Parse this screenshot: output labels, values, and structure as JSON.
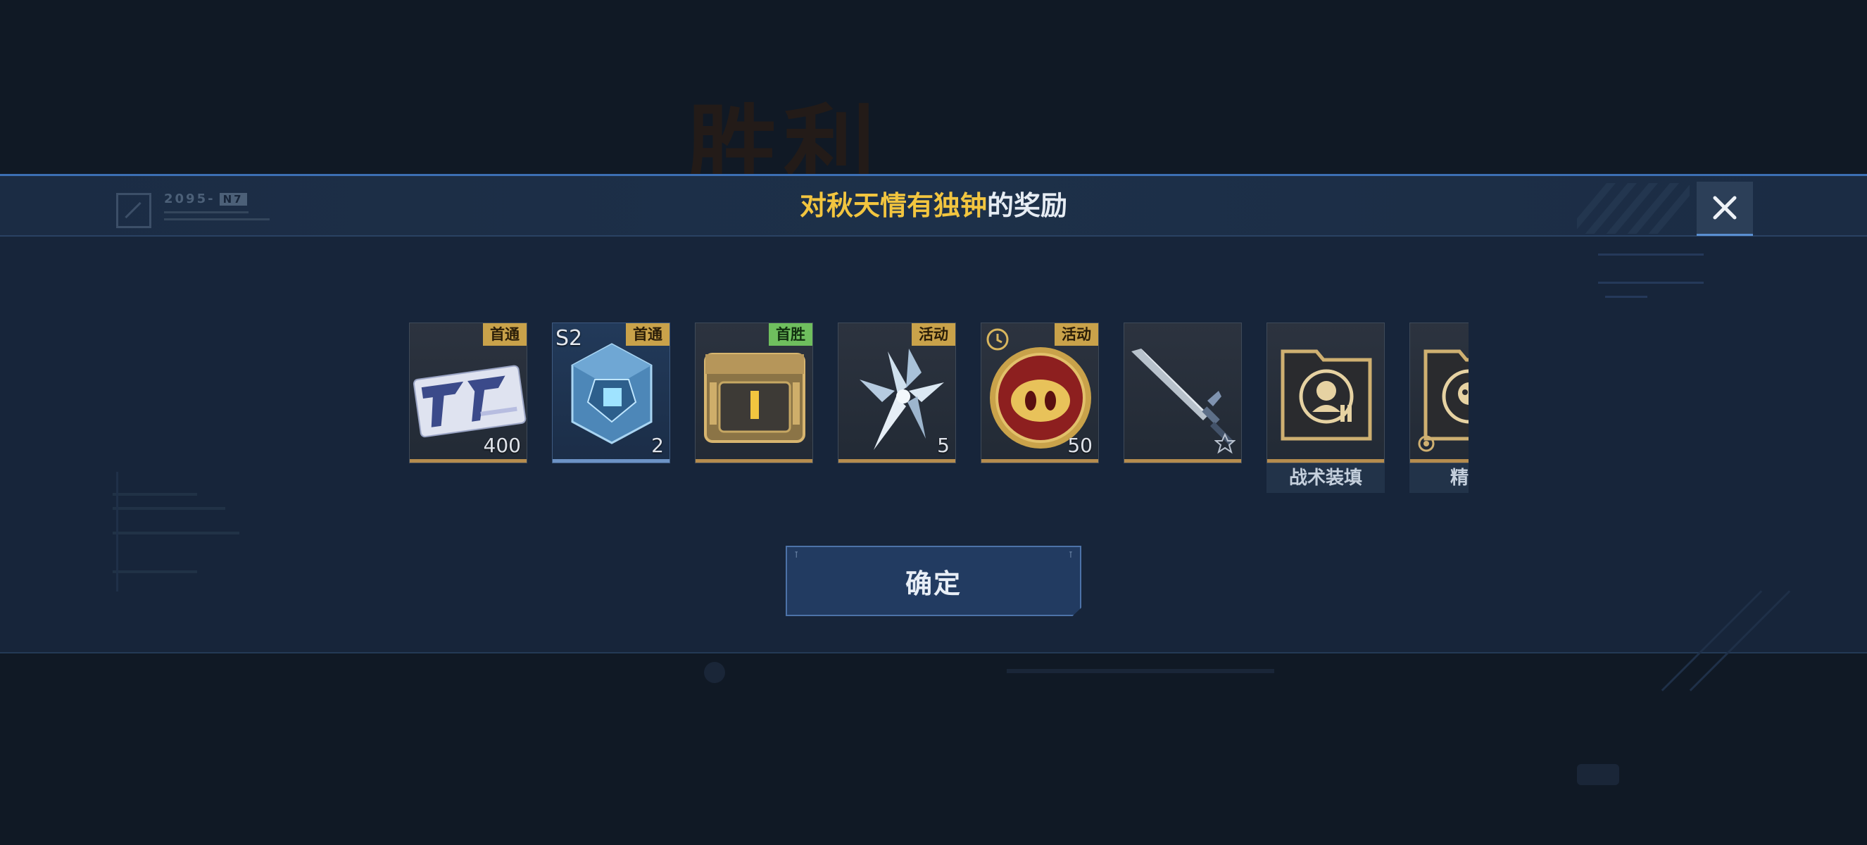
{
  "background_title": "胜利",
  "header": {
    "logo_code": "2095-",
    "logo_tag": "N7",
    "title_highlight": "对秋天情有独钟",
    "title_suffix": "的奖励"
  },
  "close_icon": "close-x-icon",
  "items": [
    {
      "icon": "ticket-card-icon",
      "badge": "首通",
      "quantity": "400"
    },
    {
      "icon": "blue-crystal-cube-icon",
      "badge": "首通",
      "season": "S2",
      "quantity": "2"
    },
    {
      "icon": "gold-crate-icon",
      "badge": "首胜"
    },
    {
      "icon": "silver-crystal-shard-icon",
      "badge": "活动",
      "quantity": "5"
    },
    {
      "icon": "pig-coin-icon",
      "badge": "活动",
      "quantity": "50",
      "timer_icon": "clock-icon"
    },
    {
      "icon": "blade-weapon-icon"
    },
    {
      "icon": "tactical-reload-folder-icon",
      "name": "战术装填"
    },
    {
      "icon": "precision-skull-folder-icon",
      "name": "精确"
    }
  ],
  "confirm_button": {
    "label": "确定"
  },
  "colors": {
    "highlight": "#f2c53f",
    "gold_badge": "#c9a24a",
    "green_badge": "#6fbf5e",
    "accent_blue": "#3c6fb4"
  }
}
